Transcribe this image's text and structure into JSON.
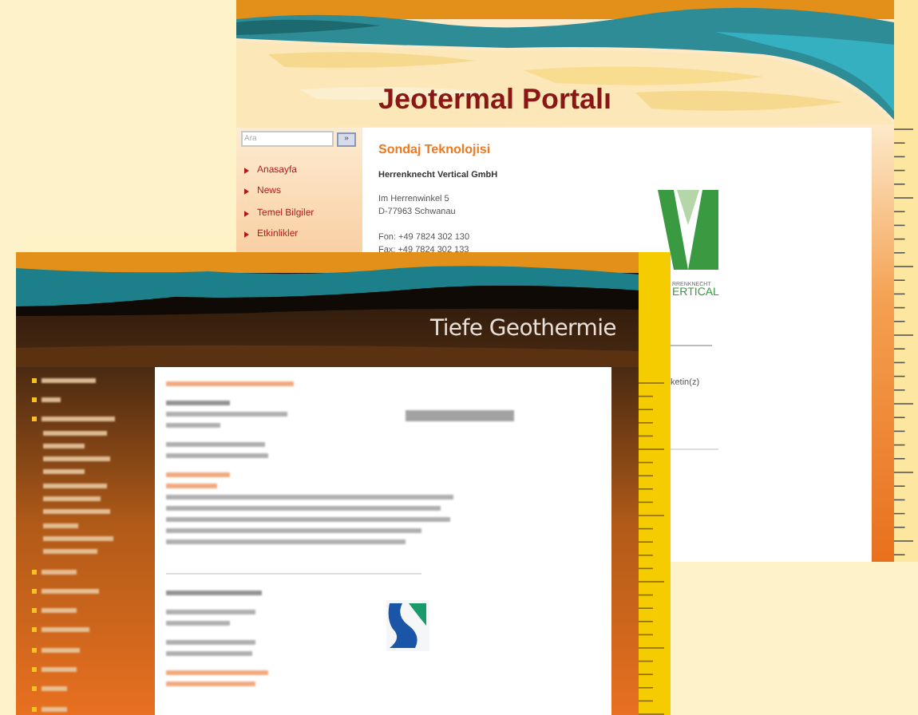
{
  "back_window": {
    "title": "Jeotermal Portalı",
    "search": {
      "placeholder": "Ara",
      "button": "»"
    },
    "menu": [
      {
        "label": "Anasayfa"
      },
      {
        "label": "News"
      },
      {
        "label": "Temel Bilgiler"
      },
      {
        "label": "Etkinlikler"
      }
    ],
    "content": {
      "heading": "Sondaj Teknolojisi",
      "company": "Herrenknecht Vertical GmbH",
      "address": [
        "Im Herrenwinkel 5",
        "D-77963 Schwanau"
      ],
      "contact": [
        "Fon: +49 7824 302 130",
        "Fax: +49 7824 302 133"
      ],
      "logo_lines": [
        "RRENKNECHT",
        "ERTICAL"
      ],
      "side_text": "ketin(z)"
    }
  },
  "front_window": {
    "title": "Tiefe Geothermie"
  }
}
